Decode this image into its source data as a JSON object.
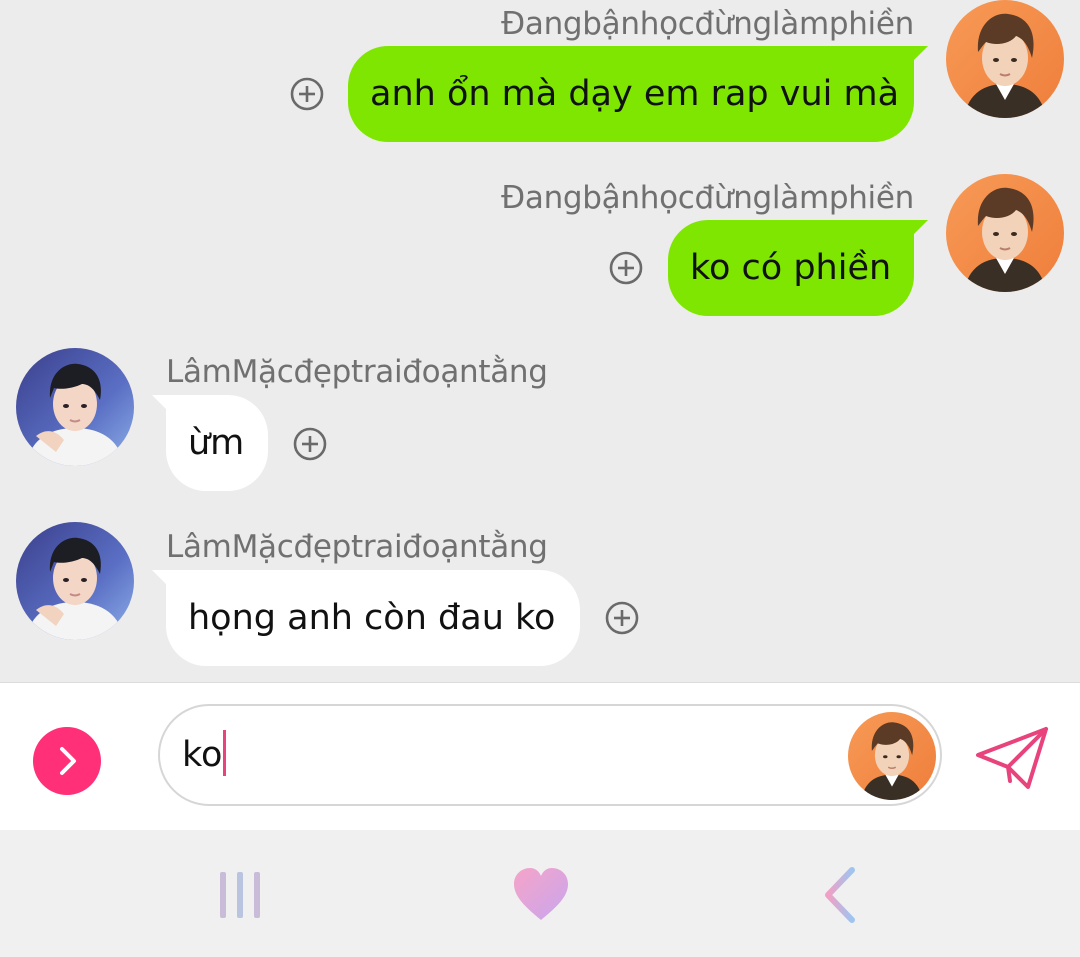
{
  "messages": [
    {
      "sender": "Đangbậnhọcđừnglàmphiền",
      "text": "anh ổn mà dạy em rap vui mà",
      "direction": "outgoing"
    },
    {
      "sender": "Đangbậnhọcđừnglàmphiền",
      "text": "ko có phiền",
      "direction": "outgoing"
    },
    {
      "sender": "LâmMặcđẹptraiđoạntằng",
      "text": "ừm",
      "direction": "incoming"
    },
    {
      "sender": "LâmMặcđẹptraiđoạntằng",
      "text": "họng anh còn đau ko",
      "direction": "incoming"
    }
  ],
  "composer": {
    "value": "ko",
    "expand_icon": "chevron-right-icon",
    "send_icon": "paper-plane-icon"
  },
  "nav": {
    "recents_icon": "recent-apps-icon",
    "home_icon": "heart-home-icon",
    "back_icon": "back-chevron-icon"
  },
  "colors": {
    "outgoing_bubble": "#7ee600",
    "incoming_bubble": "#ffffff",
    "accent": "#ff2f78",
    "chat_background": "#ececec"
  }
}
